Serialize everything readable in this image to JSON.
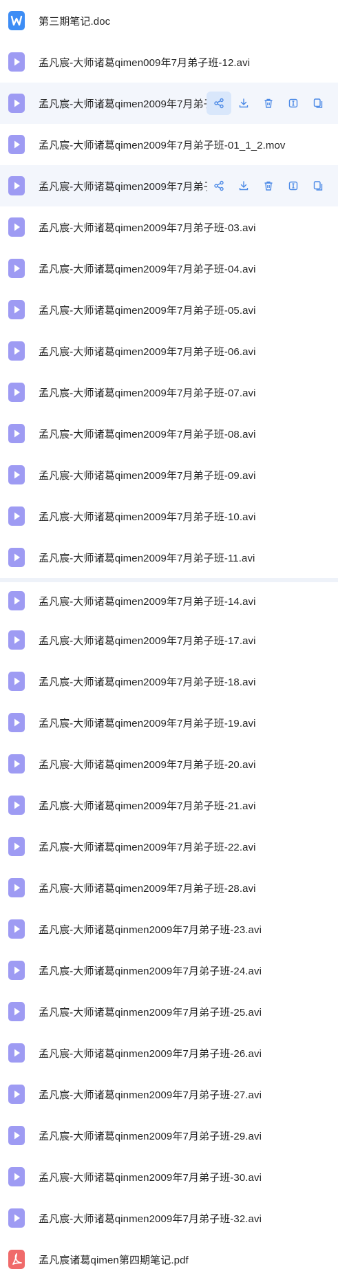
{
  "colors": {
    "video": "#9e9bf3",
    "word": "#3d8df5",
    "pdf": "#f06a6a",
    "action": "#4b89e6",
    "hover_bg": "#f3f6fc"
  },
  "files": [
    {
      "name": "第三期笔记.doc",
      "icon": "word-icon"
    },
    {
      "name": "孟凡宸-大师诸葛qimen009年7月弟子班-12.avi",
      "icon": "video-icon"
    },
    {
      "name": "孟凡宸-大师诸葛qimen2009年7月弟子",
      "icon": "video-icon",
      "hover": true
    },
    {
      "name": "孟凡宸-大师诸葛qimen2009年7月弟子班-01_1_2.mov",
      "icon": "video-icon"
    },
    {
      "name": "孟凡宸-大师诸葛qimen2009年7月弟子",
      "icon": "video-icon",
      "hover": true
    },
    {
      "name": "孟凡宸-大师诸葛qimen2009年7月弟子班-03.avi",
      "icon": "video-icon"
    },
    {
      "name": "孟凡宸-大师诸葛qimen2009年7月弟子班-04.avi",
      "icon": "video-icon"
    },
    {
      "name": "孟凡宸-大师诸葛qimen2009年7月弟子班-05.avi",
      "icon": "video-icon"
    },
    {
      "name": "孟凡宸-大师诸葛qimen2009年7月弟子班-06.avi",
      "icon": "video-icon"
    },
    {
      "name": "孟凡宸-大师诸葛qimen2009年7月弟子班-07.avi",
      "icon": "video-icon"
    },
    {
      "name": "孟凡宸-大师诸葛qimen2009年7月弟子班-08.avi",
      "icon": "video-icon"
    },
    {
      "name": "孟凡宸-大师诸葛qimen2009年7月弟子班-09.avi",
      "icon": "video-icon"
    },
    {
      "name": "孟凡宸-大师诸葛qimen2009年7月弟子班-10.avi",
      "icon": "video-icon"
    },
    {
      "name": "孟凡宸-大师诸葛qimen2009年7月弟子班-11.avi",
      "icon": "video-icon"
    },
    {
      "name": "孟凡宸-大师诸葛qimen2009年7月弟子班-14.avi",
      "icon": "video-icon"
    },
    {
      "name": "孟凡宸-大师诸葛qimen2009年7月弟子班-17.avi",
      "icon": "video-icon"
    },
    {
      "name": "孟凡宸-大师诸葛qimen2009年7月弟子班-18.avi",
      "icon": "video-icon"
    },
    {
      "name": "孟凡宸-大师诸葛qimen2009年7月弟子班-19.avi",
      "icon": "video-icon"
    },
    {
      "name": "孟凡宸-大师诸葛qimen2009年7月弟子班-20.avi",
      "icon": "video-icon"
    },
    {
      "name": "孟凡宸-大师诸葛qimen2009年7月弟子班-21.avi",
      "icon": "video-icon"
    },
    {
      "name": "孟凡宸-大师诸葛qimen2009年7月弟子班-22.avi",
      "icon": "video-icon"
    },
    {
      "name": "孟凡宸-大师诸葛qimen2009年7月弟子班-28.avi",
      "icon": "video-icon"
    },
    {
      "name": "孟凡宸-大师诸葛qinmen2009年7月弟子班-23.avi",
      "icon": "video-icon"
    },
    {
      "name": "孟凡宸-大师诸葛qinmen2009年7月弟子班-24.avi",
      "icon": "video-icon"
    },
    {
      "name": "孟凡宸-大师诸葛qinmen2009年7月弟子班-25.avi",
      "icon": "video-icon"
    },
    {
      "name": "孟凡宸-大师诸葛qinmen2009年7月弟子班-26.avi",
      "icon": "video-icon"
    },
    {
      "name": "孟凡宸-大师诸葛qinmen2009年7月弟子班-27.avi",
      "icon": "video-icon"
    },
    {
      "name": "孟凡宸-大师诸葛qinmen2009年7月弟子班-29.avi",
      "icon": "video-icon"
    },
    {
      "name": "孟凡宸-大师诸葛qinmen2009年7月弟子班-30.avi",
      "icon": "video-icon"
    },
    {
      "name": "孟凡宸-大师诸葛qinmen2009年7月弟子班-32.avi",
      "icon": "video-icon"
    },
    {
      "name": "孟凡宸诸葛qimen第四期笔记.pdf",
      "icon": "pdf-icon"
    }
  ],
  "row_actions": [
    "share-icon",
    "download-icon",
    "delete-icon",
    "rename-icon",
    "copy-icon",
    "more-icon"
  ]
}
